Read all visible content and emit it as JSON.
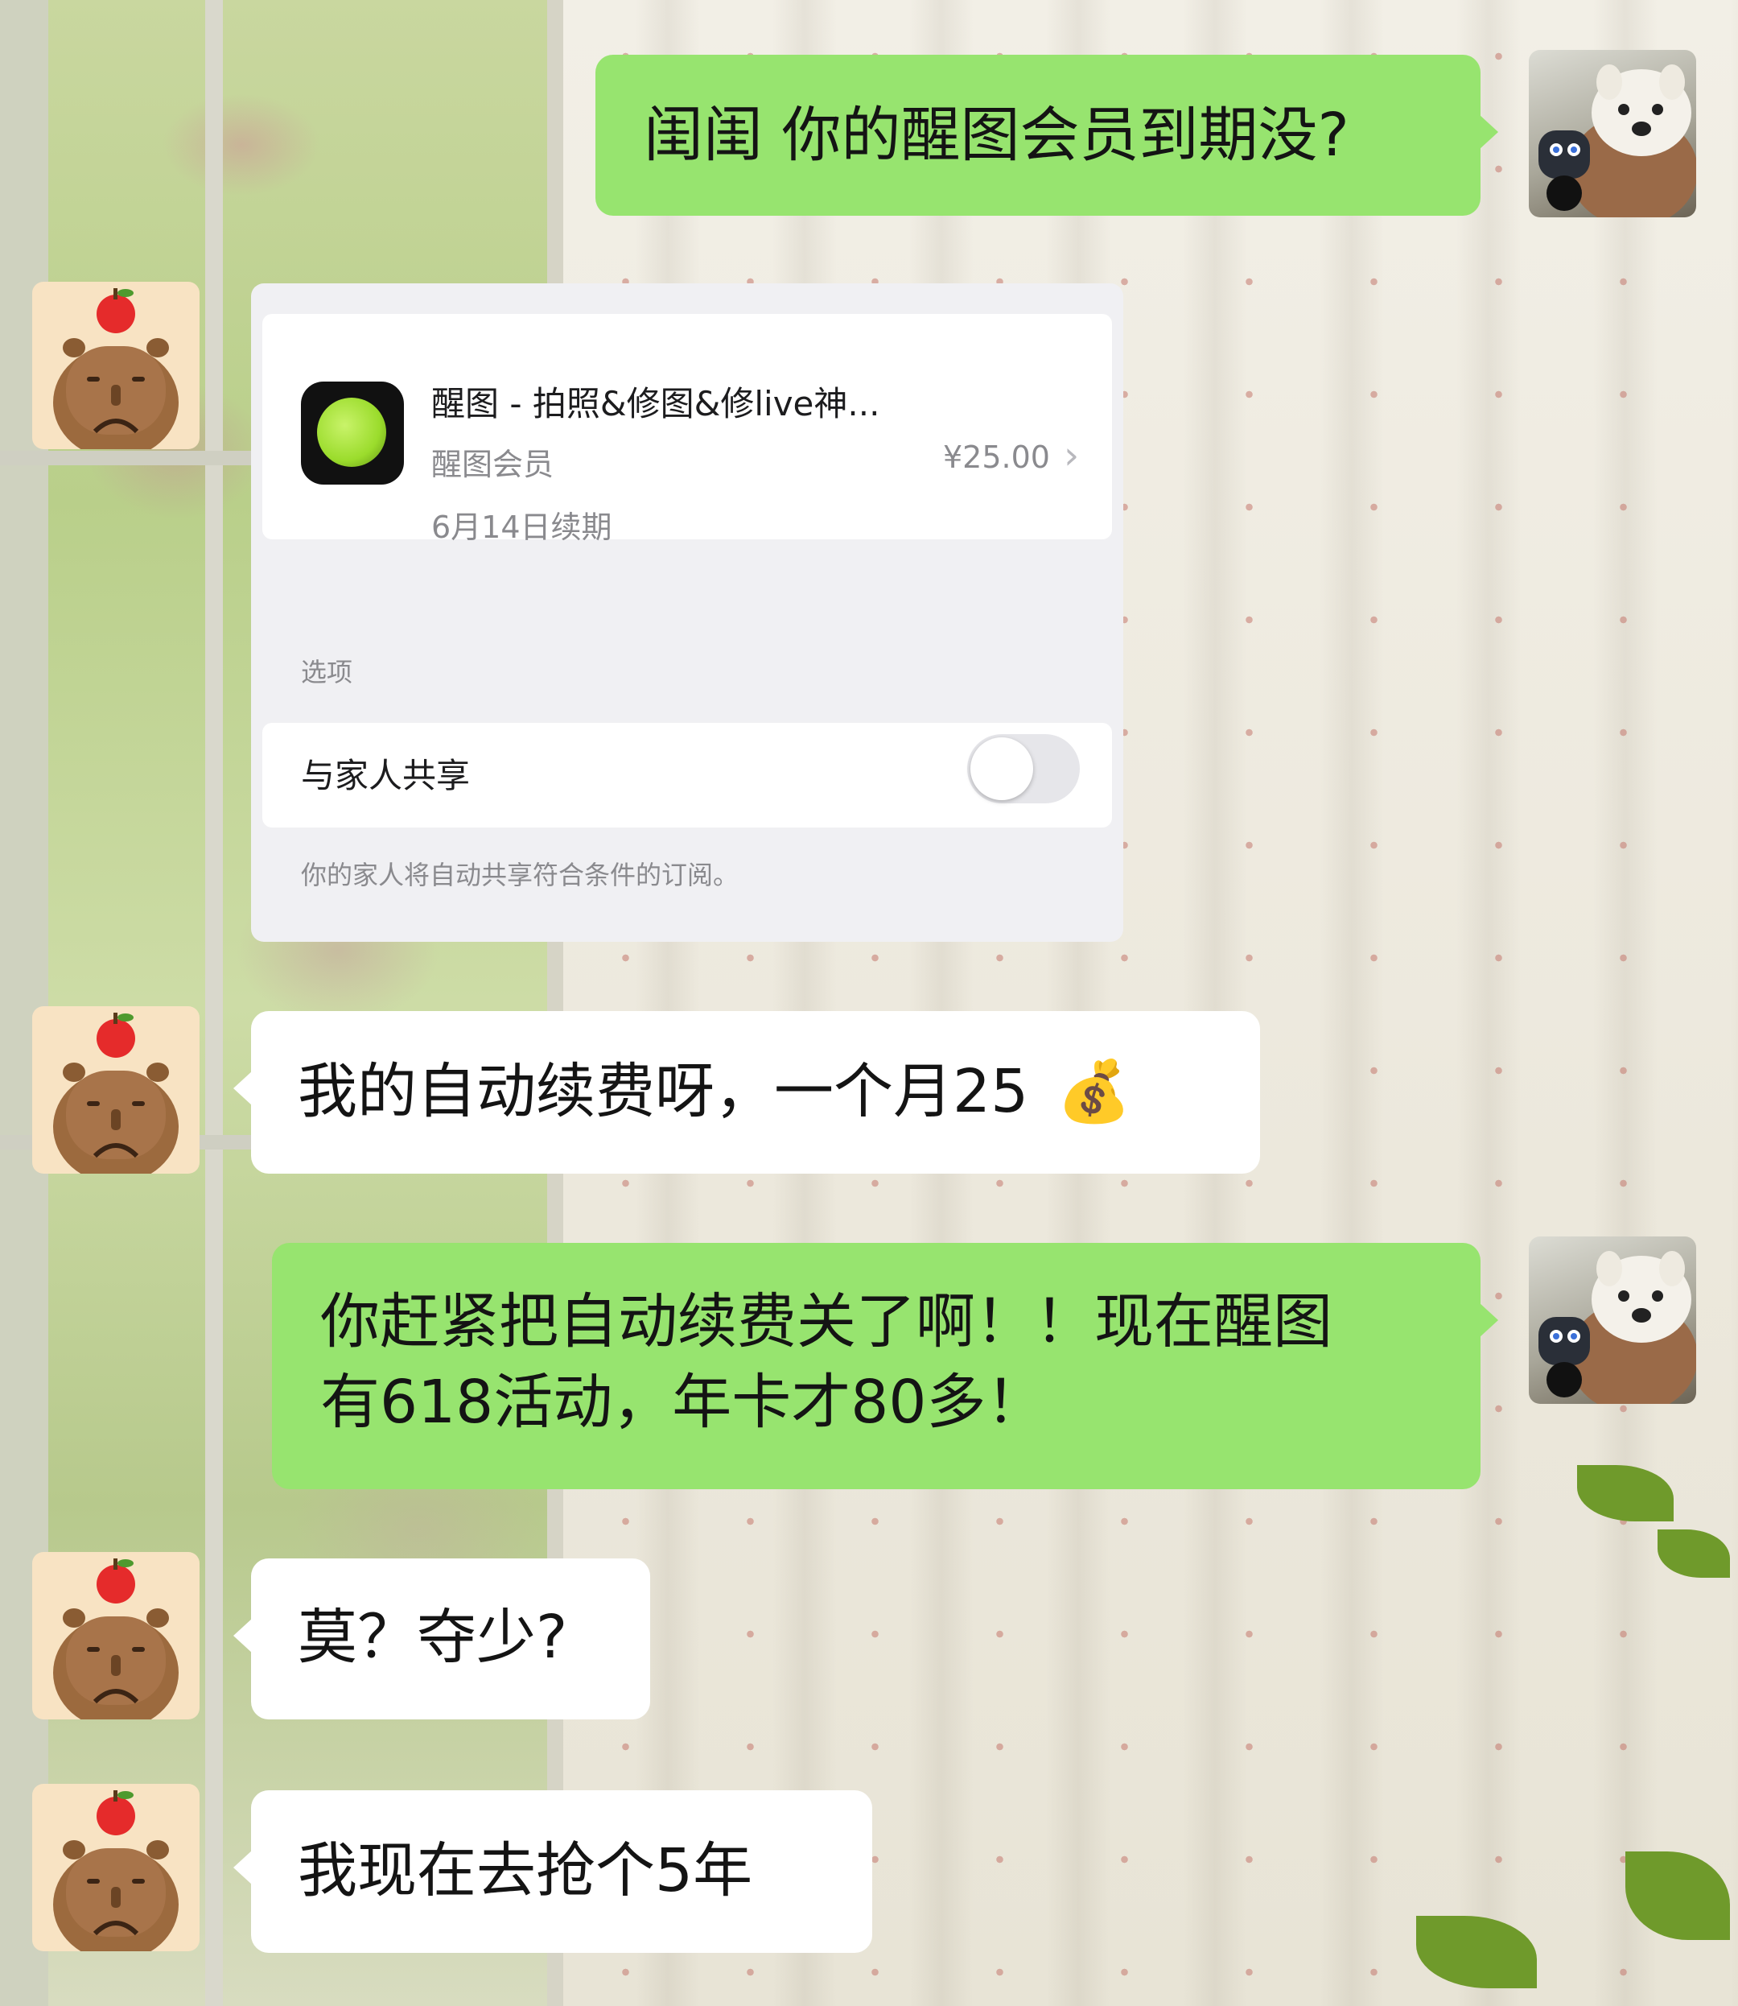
{
  "messages": [
    {
      "side": "right",
      "text": "闺闺 你的醒图会员到期没?"
    },
    {
      "side": "left",
      "type": "image-card"
    },
    {
      "side": "left",
      "text": "我的自动续费呀，一个月25",
      "emoji": "💰"
    },
    {
      "side": "right",
      "line1": "你赶紧把自动续费关了啊！！现在醒图",
      "line2": "有618活动，年卡才80多！"
    },
    {
      "side": "left",
      "text": "莫？夺少?"
    },
    {
      "side": "left",
      "text": "我现在去抢个5年"
    }
  ],
  "card": {
    "app_name": "醒图 - 拍照&修图&修live神...",
    "plan": "醒图会员",
    "renewal": "6月14日续期",
    "price": "¥25.00",
    "chevron": "›",
    "options_header": "选项",
    "share_label": "与家人共享",
    "share_on": false,
    "footnote": "你的家人将自动共享符合条件的订阅。"
  },
  "colors": {
    "green_bubble": "#97e46f",
    "white_bubble": "#ffffff",
    "card_bg": "#f0f0f3",
    "app_icon_accent": "#9bdc2c"
  },
  "icons": {
    "left_avatar": "capybara-with-apple-avatar",
    "right_avatar": "samoyed-dog-avatar",
    "chevron": "chevron-right-icon",
    "emoji": "money-bag-emoji"
  }
}
